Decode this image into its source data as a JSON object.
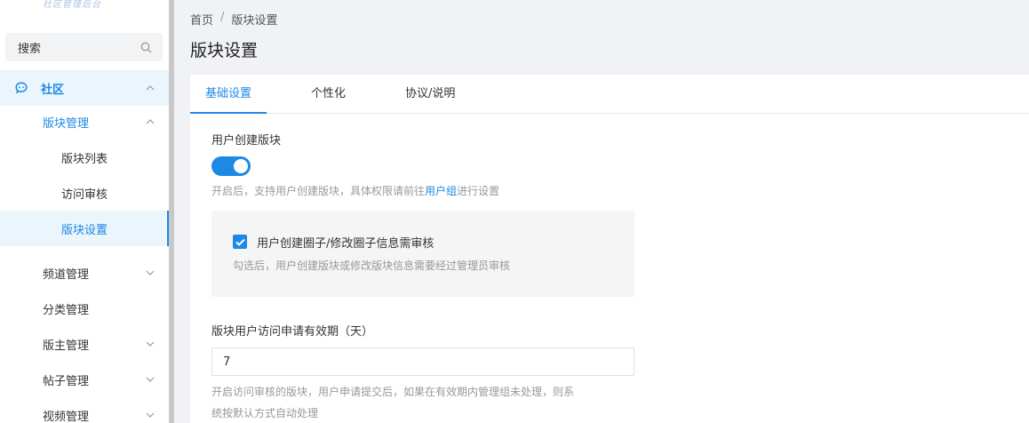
{
  "sidebar": {
    "logo_text": "社区管理后台",
    "search": {
      "placeholder": "搜索",
      "icon": "search-icon"
    },
    "community": {
      "label": "社区",
      "icon": "chat-icon",
      "expanded": true
    },
    "items": [
      {
        "label": "版块管理",
        "expanded": true
      },
      {
        "label": "版块列表"
      },
      {
        "label": "访问审核"
      },
      {
        "label": "版块设置",
        "selected": true
      },
      {
        "label": "频道管理"
      },
      {
        "label": "分类管理"
      },
      {
        "label": "版主管理"
      },
      {
        "label": "帖子管理"
      },
      {
        "label": "视频管理"
      }
    ]
  },
  "breadcrumb": {
    "home": "首页",
    "separator": "/",
    "current": "版块设置"
  },
  "page_title": "版块设置",
  "tabs": [
    {
      "label": "基础设置",
      "active": true
    },
    {
      "label": "个性化"
    },
    {
      "label": "协议/说明"
    }
  ],
  "form": {
    "user_create": {
      "label": "用户创建版块",
      "enabled": true,
      "hint_before": "开启后，支持用户创建版块，具体权限请前往",
      "hint_link": "用户组",
      "hint_after": "进行设置"
    },
    "review": {
      "checked": true,
      "label": "用户创建圈子/修改圈子信息需审核",
      "hint": "勾选后，用户创建版块或修改版块信息需要经过管理员审核"
    },
    "validity": {
      "label": "版块用户访问申请有效期（天）",
      "value": "7",
      "hint_line1": "开启访问审核的版块，用户申请提交后，如果在有效期内管理组未处理，则系",
      "hint_line2": "统按默认方式自动处理"
    }
  },
  "colors": {
    "accent": "#1e88e5",
    "selected_bg": "#eaf5fc"
  }
}
